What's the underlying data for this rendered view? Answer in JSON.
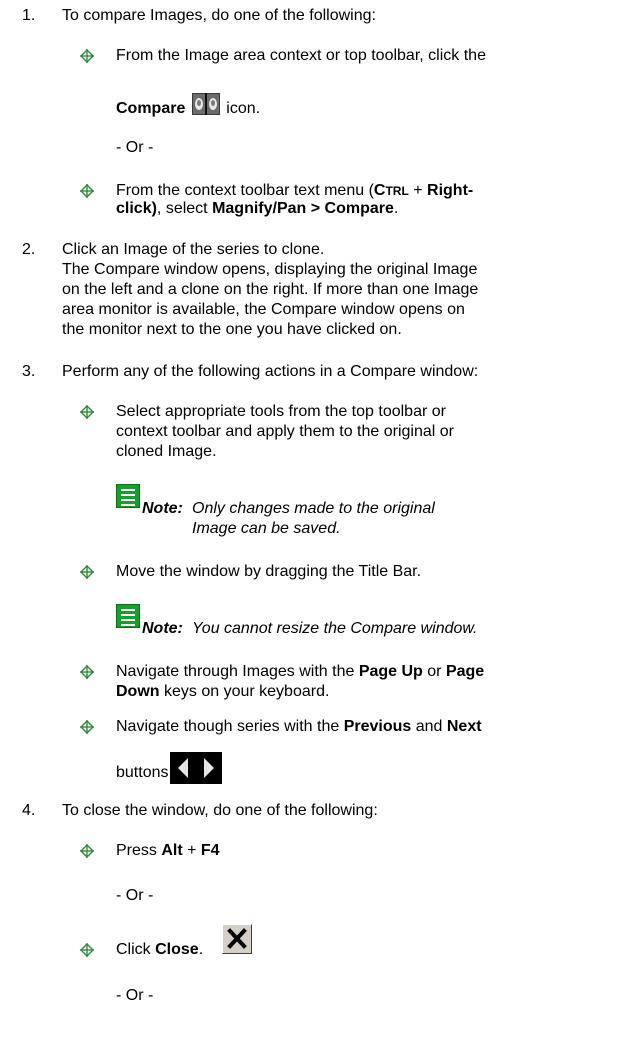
{
  "steps": [
    {
      "number": "1.",
      "text": "To compare Images, do one of the following:"
    },
    {
      "number": "2.",
      "line1": "Click an Image of the series to clone.",
      "line2": "The Compare window opens, displaying the original Image",
      "line3": "on the left and a clone on the right. If more than one Image",
      "line4": "area monitor is available, the Compare window opens on",
      "line5": "the monitor next to the one you have clicked on."
    },
    {
      "number": "3.",
      "text": "Perform any of the following actions in a Compare window:"
    },
    {
      "number": "4.",
      "text": "To close the window, do one of the following:"
    }
  ],
  "step1": {
    "b1_line1": "From the Image area context or top toolbar, click the",
    "b1_compare": "Compare",
    "b1_icon_suffix": "icon.",
    "or1": "- Or -",
    "b2_pre": "From the context toolbar text menu (",
    "b2_ctrl_C": "C",
    "b2_ctrl_rest": "TRL",
    "b2_plus": " + ",
    "b2_right": "Right-",
    "b2_click": "click)",
    "b2_mid": ", select ",
    "b2_menu": "Magnify/Pan > Compare",
    "b2_end": "."
  },
  "step3": {
    "b1_line1": "Select appropriate tools from the top toolbar or",
    "b1_line2": "context toolbar and apply them to the original or",
    "b1_line3": "cloned Image.",
    "note1_label": "Note:",
    "note1_line1": "Only changes made to the original",
    "note1_line2": "Image can be saved.",
    "b2_text": "Move the window by dragging the Title Bar.",
    "note2_label": "Note:",
    "note2_text": "You cannot resize the Compare window.",
    "b3_pre": "Navigate through Images with the ",
    "b3_pageup": "Page Up",
    "b3_or": " or ",
    "b3_page": "Page",
    "b3_down": "Down",
    "b3_rest": " keys on your keyboard.",
    "b4_pre": "Navigate though series with the ",
    "b4_prev": "Previous",
    "b4_and": " and ",
    "b4_next": "Next",
    "b4_buttons": "buttons."
  },
  "step4": {
    "b1_pre": "Press ",
    "b1_alt": "Alt",
    "b1_plus": " + ",
    "b1_f4": "F4",
    "or1": "- Or -",
    "b2_pre": "Click ",
    "b2_close": "Close",
    "b2_end": ".",
    "or2": "- Or -"
  },
  "colors": {
    "bullet_icon": "#2e8b3e",
    "note_icon": "#14a02a",
    "nav_buttons_bg": "#000000"
  },
  "icons": [
    "bullet-diamond-icon",
    "compare-icon",
    "note-icon",
    "previous-button-icon",
    "next-button-icon",
    "close-x-icon"
  ]
}
